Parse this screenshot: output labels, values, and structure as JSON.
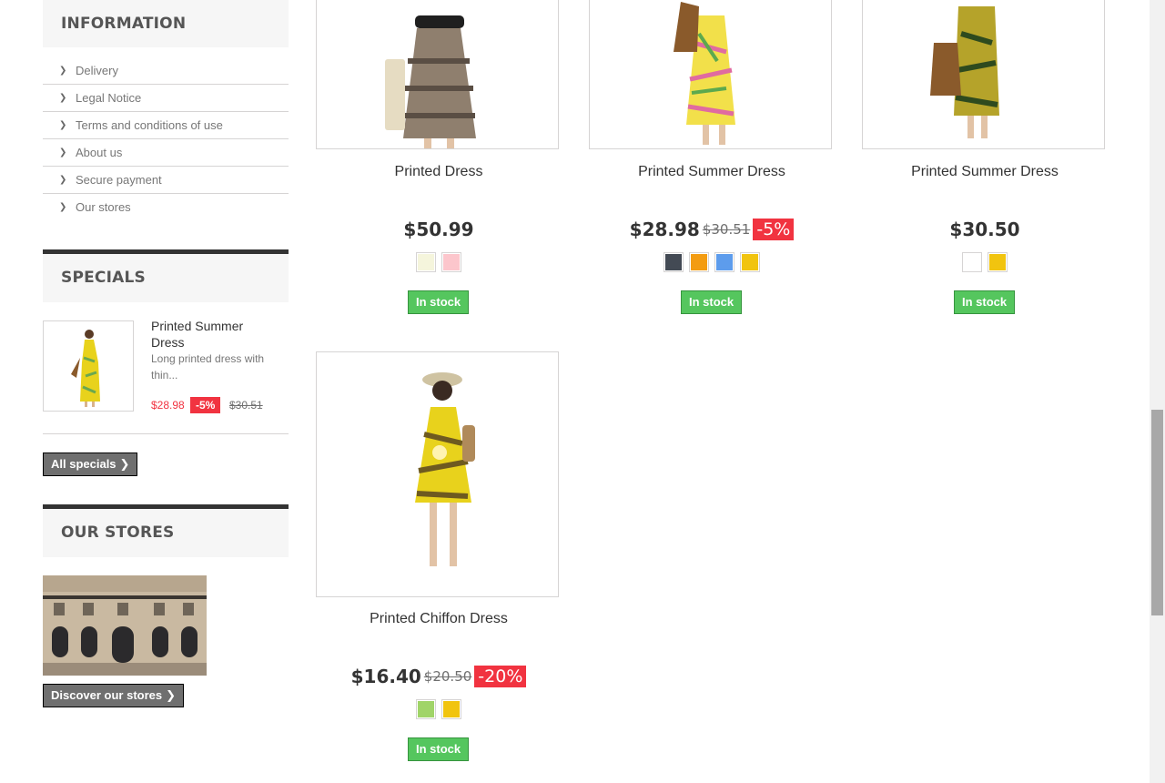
{
  "sidebar": {
    "information": {
      "title": "INFORMATION",
      "links": [
        "Delivery",
        "Legal Notice",
        "Terms and conditions of use",
        "About us",
        "Secure payment",
        "Our stores"
      ]
    },
    "specials": {
      "title": "SPECIALS",
      "product": {
        "name": "Printed Summer Dress",
        "description": "Long printed dress with thin...",
        "price": "$28.98",
        "discount": "-5%",
        "old_price": "$30.51"
      },
      "button_label": "All specials"
    },
    "stores": {
      "title": "OUR STORES",
      "button_label": "Discover our stores"
    }
  },
  "products": [
    {
      "name": "Printed Dress",
      "price": "$50.99",
      "old_price": "",
      "discount": "",
      "colors": [
        "#f5f5dc",
        "#fcc6cc"
      ],
      "stock": "In stock"
    },
    {
      "name": "Printed Summer Dress",
      "price": "$28.98",
      "old_price": "$30.51",
      "discount": "-5%",
      "colors": [
        "#434a54",
        "#f39c11",
        "#5d9cec",
        "#f1c40f"
      ],
      "stock": "In stock"
    },
    {
      "name": "Printed Summer Dress",
      "price": "$30.50",
      "old_price": "",
      "discount": "",
      "colors": [
        "#ffffff",
        "#f1c40f"
      ],
      "stock": "In stock"
    },
    {
      "name": "Printed Chiffon Dress",
      "price": "$16.40",
      "old_price": "$20.50",
      "discount": "-20%",
      "colors": [
        "#a0d468",
        "#f1c40f"
      ],
      "stock": "In stock"
    }
  ],
  "icons": {
    "list_bullet": "chevron-right-icon",
    "button_arrow": "chevron-right-icon"
  },
  "colors": {
    "accent_red": "#f13340",
    "stock_green": "#55c65e",
    "dark_button": "#6f6f6f"
  }
}
